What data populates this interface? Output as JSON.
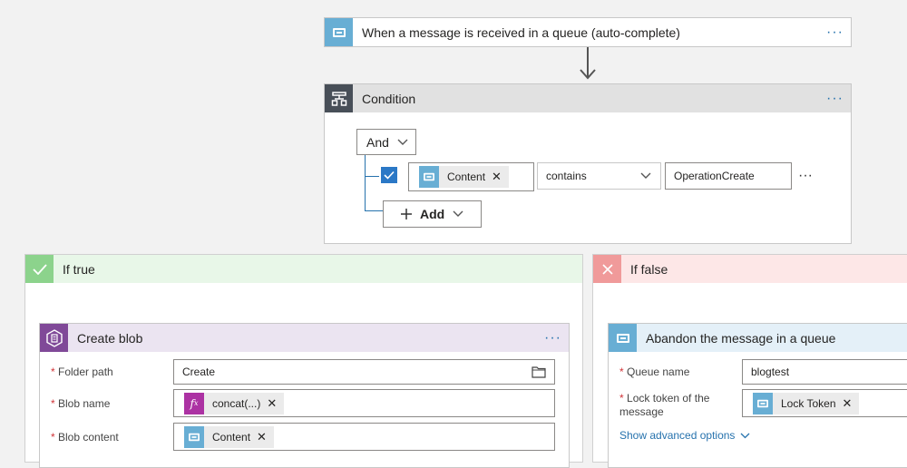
{
  "trigger": {
    "title": "When a message is received in a queue (auto-complete)",
    "more": "···"
  },
  "condition": {
    "title": "Condition",
    "more": "···",
    "group_operator": "And",
    "row": {
      "left_token": "Content",
      "operator": "contains",
      "value": "OperationCreate",
      "more": "···"
    },
    "add_label": "Add"
  },
  "if_true": {
    "title": "If true",
    "action": {
      "title": "Create blob",
      "more": "···",
      "fields": [
        {
          "label": "Folder path",
          "value": "Create"
        },
        {
          "label": "Blob name",
          "token": "concat(...)"
        },
        {
          "label": "Blob content",
          "token": "Content"
        }
      ]
    }
  },
  "if_false": {
    "title": "If false",
    "action": {
      "title": "Abandon the message in a queue",
      "fields": [
        {
          "label": "Queue name",
          "value": "blogtest"
        },
        {
          "label_line1": "Lock token of the",
          "label_line2": "message",
          "token": "Lock Token"
        }
      ],
      "advanced": "Show advanced options"
    }
  },
  "colors": {
    "trigger_accent": "#68aed4",
    "condition_accent": "#484f58",
    "true_accent": "#8cd38c",
    "false_accent": "#f09a9a",
    "blob_accent": "#804998",
    "expr_accent": "#ac32a3",
    "link": "#2672ad"
  }
}
